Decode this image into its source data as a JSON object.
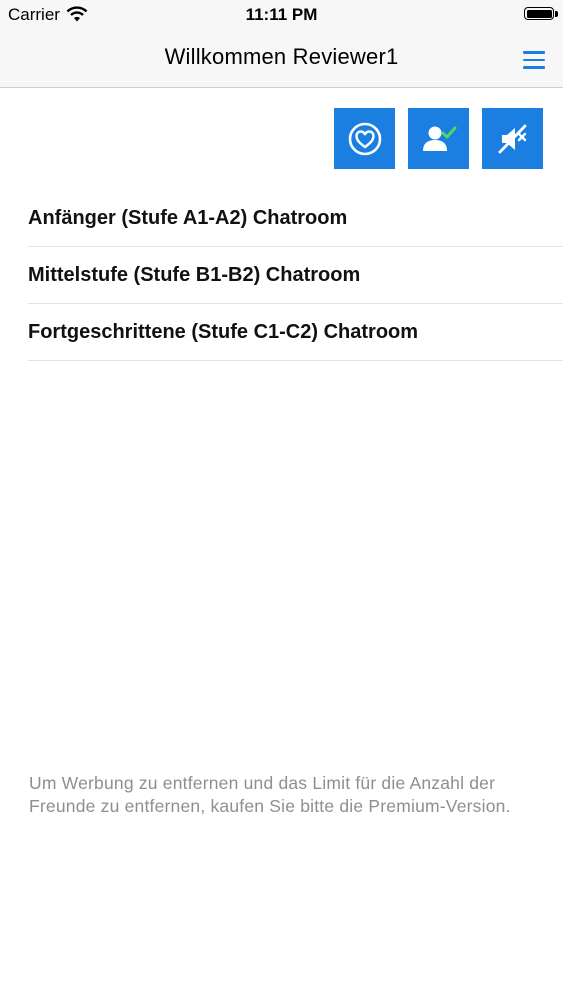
{
  "status_bar": {
    "carrier": "Carrier",
    "time": "11:11 PM",
    "wifi_icon": "wifi-icon",
    "battery_icon": "battery-icon"
  },
  "nav": {
    "title": "Willkommen Reviewer1",
    "menu_icon": "hamburger-menu-icon"
  },
  "actions": [
    {
      "name": "favorites",
      "icon": "heart-icon"
    },
    {
      "name": "friends",
      "icon": "user-check-icon"
    },
    {
      "name": "mute",
      "icon": "speaker-muted-icon"
    }
  ],
  "rooms": [
    {
      "label": "Anfänger (Stufe A1-A2) Chatroom"
    },
    {
      "label": "Mittelstufe (Stufe B1-B2) Chatroom"
    },
    {
      "label": "Fortgeschrittene (Stufe C1-C2) Chatroom"
    }
  ],
  "premium_note": "Um Werbung zu entfernen und das Limit für die Anzahl der Freunde zu entfernen, kaufen Sie bitte die Premium-Version.",
  "colors": {
    "accent": "#1a7fe0",
    "check": "#4cd964",
    "note_text": "#8e8e93"
  }
}
